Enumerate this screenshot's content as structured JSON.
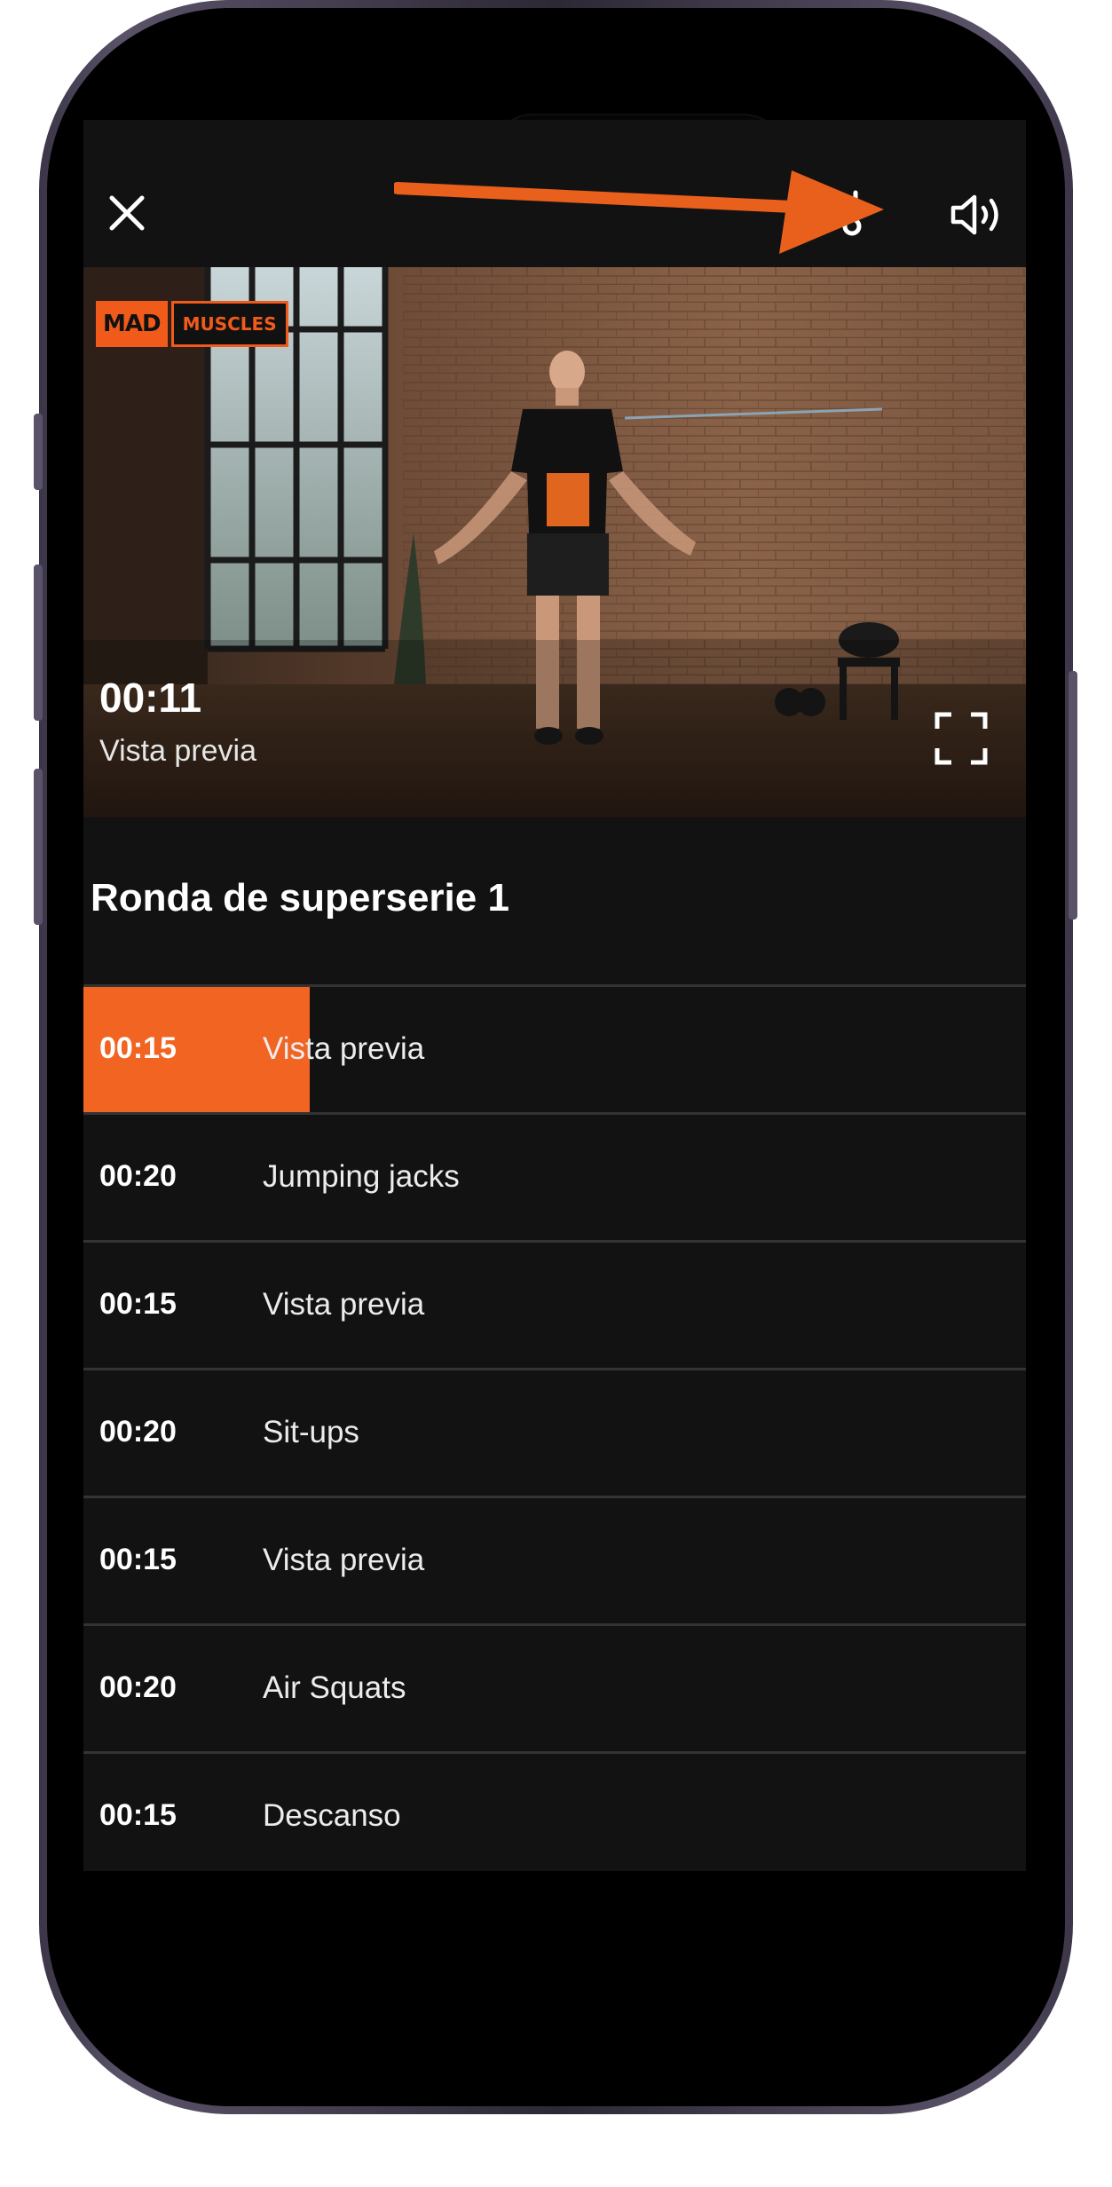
{
  "colors": {
    "accent": "#f26422",
    "background": "#121212",
    "divider": "#333333",
    "annotation_arrow": "#e8601c"
  },
  "icons": {
    "close": "close-icon",
    "settings": "settings-icon",
    "volume": "volume-icon",
    "fullscreen": "fullscreen-icon"
  },
  "video": {
    "brand_left": "MAD",
    "brand_right": "MUSCLES",
    "time": "00:11",
    "label": "Vista previa"
  },
  "section": {
    "title": "Ronda de superserie 1"
  },
  "exercises": [
    {
      "duration": "00:15",
      "name": "Vista previa",
      "active": true,
      "progress": 0.24
    },
    {
      "duration": "00:20",
      "name": "Jumping jacks"
    },
    {
      "duration": "00:15",
      "name": "Vista previa"
    },
    {
      "duration": "00:20",
      "name": "Sit-ups"
    },
    {
      "duration": "00:15",
      "name": "Vista previa"
    },
    {
      "duration": "00:20",
      "name": "Air Squats"
    },
    {
      "duration": "00:15",
      "name": "Descanso"
    }
  ]
}
